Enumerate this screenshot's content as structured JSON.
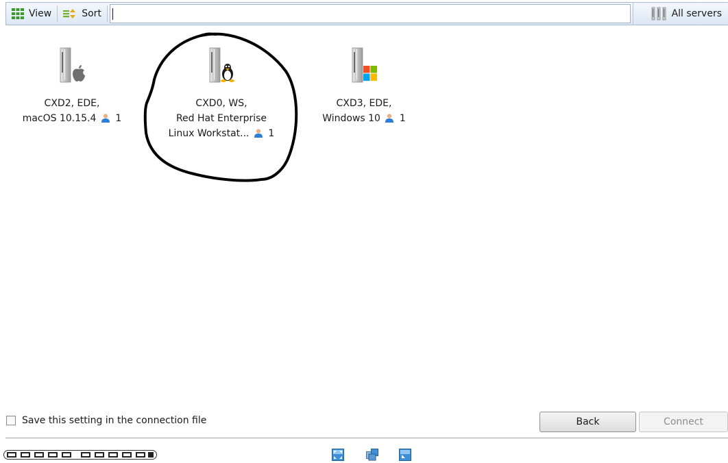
{
  "toolbar": {
    "view_label": "View",
    "sort_label": "Sort",
    "search_value": "",
    "all_servers_label": "All servers"
  },
  "servers": [
    {
      "line1": "CXD2, EDE,",
      "line2": "macOS 10.15.4",
      "line3": "",
      "users": "1",
      "os": "apple-icon"
    },
    {
      "line1": "CXD0, WS,",
      "line2": "Red Hat Enterprise",
      "line3": "Linux Workstat...",
      "users": "1",
      "os": "linux-tux-icon"
    },
    {
      "line1": "CXD3, EDE,",
      "line2": "Windows 10",
      "line3": "",
      "users": "1",
      "os": "windows-icon"
    }
  ],
  "footer": {
    "save_setting_label": "Save this setting in the connection file",
    "save_setting_checked": false,
    "back_label": "Back",
    "connect_label": "Connect",
    "logo_text": "CLOUD SERVER"
  },
  "colors": {
    "accent_blue": "#2a7fd4",
    "annotation_ink": "#000000",
    "windows_red": "#f25022",
    "windows_green": "#7fba00",
    "windows_blue": "#00a4ef",
    "windows_yellow": "#ffb900"
  }
}
